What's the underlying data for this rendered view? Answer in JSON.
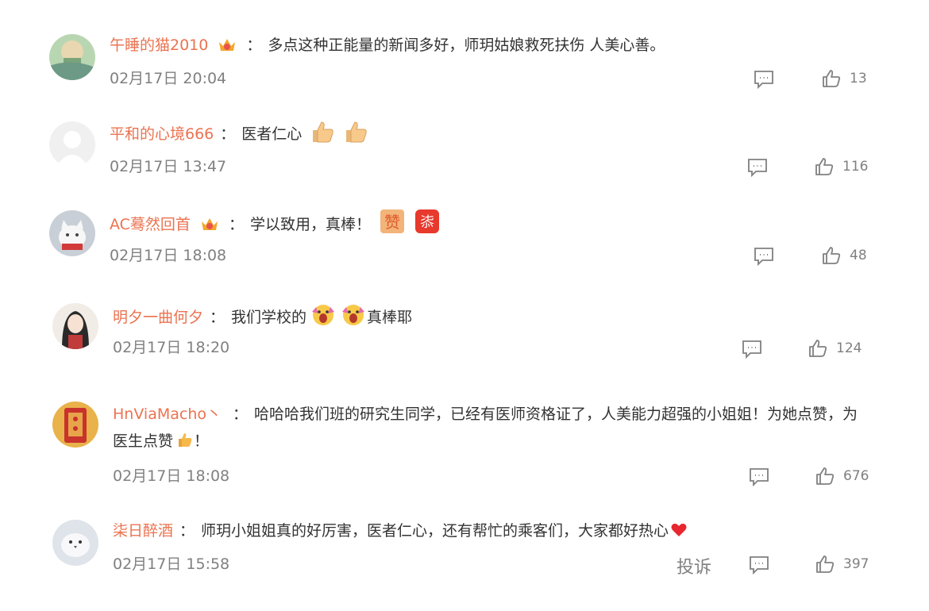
{
  "comments": [
    {
      "user": "午睡的猫2010",
      "has_badge": true,
      "sep": "：",
      "text": "多点这种正能量的新闻多好，师玥姑娘救死扶伤 人美心善。",
      "time": "02月17日 20:04",
      "likes": "13"
    },
    {
      "user": "平和的心境666",
      "has_badge": false,
      "sep": "：",
      "text": "医者仁心",
      "emojis": [
        "thumbs-up-icon",
        "thumbs-up-icon"
      ],
      "time": "02月17日 13:47",
      "likes": "116"
    },
    {
      "user": "AC蓦然回首",
      "has_badge": true,
      "sep": "：",
      "text": "学以致用，真棒！",
      "emojis": [
        "zan-sticker-icon",
        "jiayou-sticker-icon"
      ],
      "emoji_text": {
        "zan": "赞",
        "jiayou": "㓒"
      },
      "time": "02月17日 18:08",
      "likes": "48"
    },
    {
      "user": "明夕一曲何夕",
      "has_badge": false,
      "sep": "：",
      "text": "我们学校的",
      "emojis": [
        "cheer-face-icon",
        "cheer-face-icon"
      ],
      "text_after": "真棒耶",
      "time": "02月17日 18:20",
      "likes": "124"
    },
    {
      "user": "HnViaMacho丶",
      "has_badge": false,
      "sep": "：",
      "text": "哈哈哈我们班的研究生同学，已经有医师资格证了，人美能力超强的小姐姐！为她点赞，为医生点赞",
      "emojis": [
        "thumbs-up-small-icon"
      ],
      "text_after": "！",
      "time": "02月17日 18:08",
      "likes": "676"
    },
    {
      "user": "柒日醉酒",
      "has_badge": false,
      "sep": "：",
      "text": "师玥小姐姐真的好厉害，医者仁心，还有帮忙的乘客们，大家都好热心",
      "emojis": [
        "heart-icon"
      ],
      "time": "02月17日 15:58",
      "likes": "397",
      "report_label": "投诉"
    }
  ],
  "colors": {
    "username": "#eb7350",
    "text": "#333333",
    "meta": "#808080"
  }
}
